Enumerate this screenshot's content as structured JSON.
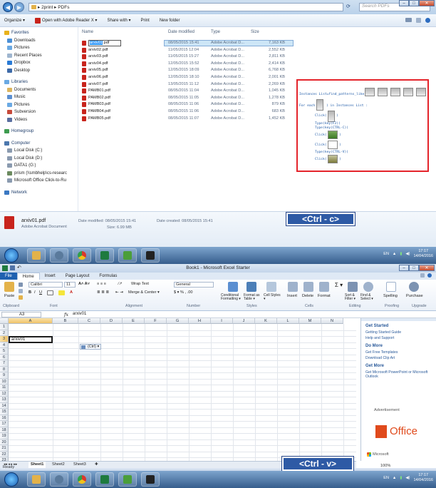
{
  "explorer": {
    "breadcrumb": "▸ 2print ▸ PDFs",
    "search_placeholder": "Search PDFs",
    "toolbar": [
      "Organize ▾",
      "Open with Adobe Reader X ▾",
      "Share with ▾",
      "Print",
      "New folder"
    ],
    "columns": {
      "name": "Name",
      "date": "Date modified",
      "type": "Type",
      "size": "Size"
    },
    "nav": [
      {
        "label": "Favorites",
        "icon": "star-icon",
        "color": "#e8b21c",
        "level": 0
      },
      {
        "label": "Downloads",
        "icon": "folder-icon",
        "color": "#4a8fd6",
        "level": 1
      },
      {
        "label": "Pictures",
        "icon": "folder-icon",
        "color": "#6aa9e3",
        "level": 1
      },
      {
        "label": "Recent Places",
        "icon": "folder-icon",
        "color": "#9fb6cf",
        "level": 1
      },
      {
        "label": "Dropbox",
        "icon": "dropbox-icon",
        "color": "#2a7bd6",
        "level": 1
      },
      {
        "label": "Desktop",
        "icon": "folder-icon",
        "color": "#3d6aa8",
        "level": 1
      },
      {
        "label": "Libraries",
        "icon": "library-icon",
        "color": "#6aa9e3",
        "level": 0,
        "gap": true
      },
      {
        "label": "Documents",
        "icon": "folder-icon",
        "color": "#dcb55e",
        "level": 1
      },
      {
        "label": "Music",
        "icon": "music-icon",
        "color": "#5b8fd1",
        "level": 1
      },
      {
        "label": "Pictures",
        "icon": "folder-icon",
        "color": "#6aa9e3",
        "level": 1
      },
      {
        "label": "Subversion",
        "icon": "folder-icon",
        "color": "#c7493a",
        "level": 1
      },
      {
        "label": "Videos",
        "icon": "folder-icon",
        "color": "#5a6fa0",
        "level": 1
      },
      {
        "label": "Homegroup",
        "icon": "homegroup-icon",
        "color": "#3e9b4f",
        "level": 0,
        "gap": true
      },
      {
        "label": "Computer",
        "icon": "computer-icon",
        "color": "#4b77ad",
        "level": 0,
        "gap": true
      },
      {
        "label": "Local Disk (C:)",
        "icon": "drive-icon",
        "color": "#8a9aaf",
        "level": 1
      },
      {
        "label": "Local Disk (D:)",
        "icon": "drive-icon",
        "color": "#8a9aaf",
        "level": 1
      },
      {
        "label": "DATA1 (G:)",
        "icon": "drive-icon",
        "color": "#8a9aaf",
        "level": 1
      },
      {
        "label": "prism (\\\\smbhelp\\cs-researc",
        "icon": "network-drive-icon",
        "color": "#6b8a5f",
        "level": 1
      },
      {
        "label": "Microsoft Office Click-to-Ru",
        "icon": "drive-icon",
        "color": "#8a9aaf",
        "level": 1
      },
      {
        "label": "Network",
        "icon": "network-icon",
        "color": "#3a78c2",
        "level": 0,
        "gap": true
      }
    ],
    "files": [
      {
        "name": "arxiv01.pdf",
        "rename_selected": "arxiv01",
        "rename_rest": ".pdf",
        "date": "08/05/2015 15:41",
        "type": "Adobe Acrobat D...",
        "size": "7,163 KB",
        "selected": true
      },
      {
        "name": "arxiv02.pdf",
        "date": "11/05/2015 12:04",
        "type": "Adobe Acrobat D...",
        "size": "2,552 KB"
      },
      {
        "name": "arxiv03.pdf",
        "date": "11/05/2015 15:27",
        "type": "Adobe Acrobat D...",
        "size": "2,811 KB"
      },
      {
        "name": "arxiv04.pdf",
        "date": "12/05/2015 15:52",
        "type": "Adobe Acrobat D...",
        "size": "2,414 KB"
      },
      {
        "name": "arxiv05.pdf",
        "date": "12/05/2015 18:09",
        "type": "Adobe Acrobat D...",
        "size": "6,768 KB"
      },
      {
        "name": "arxiv06.pdf",
        "date": "12/05/2015 18:10",
        "type": "Adobe Acrobat D...",
        "size": "2,001 KB"
      },
      {
        "name": "arxiv07.pdf",
        "date": "13/05/2015 11:12",
        "type": "Adobe Acrobat D...",
        "size": "2,269 KB"
      },
      {
        "name": "PAMB01.pdf",
        "date": "08/05/2015 11:04",
        "type": "Adobe Acrobat D...",
        "size": "1,045 KB"
      },
      {
        "name": "PAMB02.pdf",
        "date": "08/05/2015 11:05",
        "type": "Adobe Acrobat D...",
        "size": "1,278 KB"
      },
      {
        "name": "PAMB03.pdf",
        "date": "08/05/2015 11:06",
        "type": "Adobe Acrobat D...",
        "size": "879 KB"
      },
      {
        "name": "PAMB04.pdf",
        "date": "08/05/2015 11:06",
        "type": "Adobe Acrobat D...",
        "size": "683 KB"
      },
      {
        "name": "PAMB05.pdf",
        "date": "08/05/2015 11:07",
        "type": "Adobe Acrobat D...",
        "size": "1,452 KB"
      }
    ],
    "details": {
      "filename": "arxiv01.pdf",
      "filetype": "Adobe Acrobat Document",
      "modified": "Date modified: 08/05/2015 15:41",
      "size": "Size: 6.99 MB",
      "created": "Date created: 08/05/2015 15:41"
    },
    "script": {
      "line1": "Instances List=find_patterns_like(",
      "line2a": "For each (",
      "line2b": ") in Instances List :",
      "click": "Click(",
      "close": ")",
      "type1": "Type(key(F2))",
      "type2": "Type(key(CTRL-C))",
      "type3": "Type(key(CTRL-V))"
    }
  },
  "overlays": {
    "ctrl_c": "<Ctrl - c>",
    "ctrl_v": "<Ctrl - v>"
  },
  "taskbar": {
    "lang": "EN",
    "time": "17:17",
    "date": "14/04/2016"
  },
  "excel": {
    "title": "Book1 - Microsoft Excel Starter",
    "tabs": [
      "File",
      "Home",
      "Insert",
      "Page Layout",
      "Formulas"
    ],
    "font_name": "Calibri",
    "font_size": "11",
    "number_format": "General",
    "ribbon_labels": {
      "paste": "Paste",
      "wrap": "Wrap Text",
      "merge": "Merge & Center ▾",
      "cond": "Conditional Formatting ▾",
      "fmt_table": "Format as Table ▾",
      "cell_styles": "Cell Styles ▾",
      "insert": "Insert",
      "delete": "Delete",
      "format": "Format",
      "sort": "Sort & Filter ▾",
      "find": "Find & Select ▾",
      "spelling": "Spelling",
      "purchase": "Purchase"
    },
    "groups": [
      "Clipboard",
      "Font",
      "Alignment",
      "Number",
      "Styles",
      "Cells",
      "Editing",
      "Proofing",
      "Upgrade"
    ],
    "name_box": "A3",
    "fx": "fx",
    "formula": "arxiv01",
    "columns": [
      "A",
      "B",
      "C",
      "D",
      "E",
      "F",
      "G",
      "H",
      "I",
      "J",
      "K",
      "L",
      "M",
      "N"
    ],
    "rows": [
      "1",
      "2",
      "3",
      "4",
      "5",
      "6",
      "7",
      "8",
      "9",
      "10",
      "11",
      "12",
      "13",
      "14",
      "15",
      "16",
      "17",
      "18",
      "19",
      "20",
      "21",
      "22",
      "23"
    ],
    "cell_a3": "arxiv01",
    "paste_options": "(Ctrl) ▾",
    "sheets": [
      "Sheet1",
      "Sheet2",
      "Sheet3"
    ],
    "status": "Ready",
    "zoom": "100%",
    "pane": {
      "title": "Get Started",
      "link1": "Getting Started Guide",
      "link2": "Help and Support",
      "do_more": "Do More",
      "link3": "Get Free Templates",
      "link4": "Download Clip Art",
      "get_more": "Get More",
      "link5": "Get Microsoft PowerPoint or Microsoft Outlook",
      "ad": "Advertisement",
      "office": "Office",
      "microsoft": "Microsoft"
    }
  }
}
